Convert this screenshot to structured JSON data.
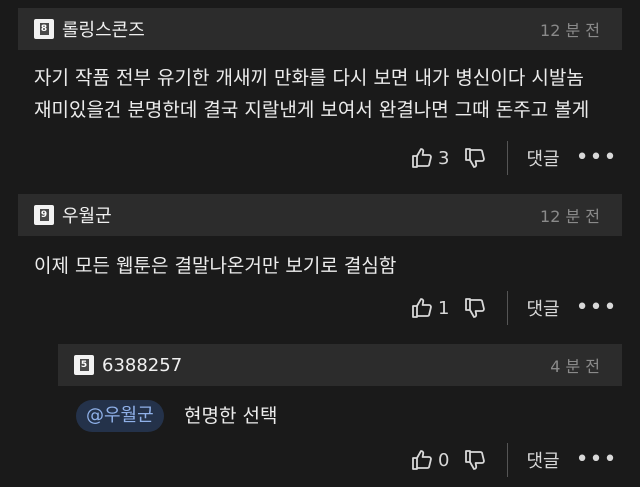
{
  "comments": [
    {
      "level": "8",
      "author": "롤링스콘즈",
      "time": "12 분 전",
      "text_line1": "자기 작품 전부 유기한 개새끼 만화를 다시 보면 내가 병신이다 시발놈",
      "text_line2": "재미있을건 분명한데 결국 지랄낸게 보여서 완결나면 그때 돈주고 볼게",
      "likes": "3",
      "reply_label": "댓글"
    },
    {
      "level": "9",
      "author": "우월군",
      "time": "12 분 전",
      "text_line1": "이제 모든 웹툰은 결말나온거만 보기로 결심함",
      "likes": "1",
      "reply_label": "댓글"
    },
    {
      "level": "5",
      "author": "6388257",
      "time": "4 분 전",
      "mention": "@우월군",
      "text_line1": "현명한 선택",
      "likes": "0",
      "reply_label": "댓글"
    }
  ],
  "more_glyph": "•••",
  "colors": {
    "background": "#1a1a1a",
    "header_bg": "#2c2c2c",
    "mention_bg": "#24324a",
    "mention_text": "#8fb0e8"
  }
}
